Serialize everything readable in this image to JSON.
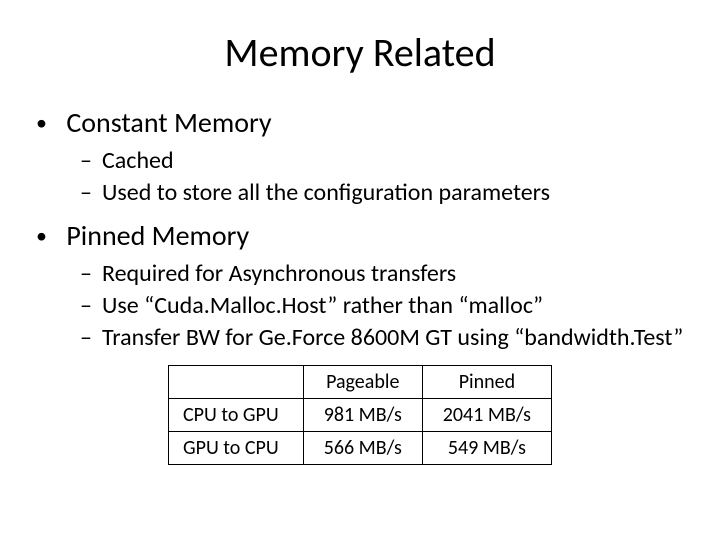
{
  "title": "Memory Related",
  "bullets": [
    {
      "text": "Constant Memory",
      "sub": [
        "Cached",
        "Used to store all the configuration parameters"
      ]
    },
    {
      "text": "Pinned Memory",
      "sub": [
        "Required for Asynchronous transfers",
        "Use “Cuda.Malloc.Host” rather than “malloc”",
        "Transfer BW for Ge.Force 8600M GT using “bandwidth.Test”"
      ]
    }
  ],
  "table": {
    "headers": [
      "",
      "Pageable",
      "Pinned"
    ],
    "rows": [
      {
        "label": "CPU to GPU",
        "pageable": "981 MB/s",
        "pinned": "2041 MB/s"
      },
      {
        "label": "GPU to CPU",
        "pageable": "566 MB/s",
        "pinned": "549 MB/s"
      }
    ]
  }
}
